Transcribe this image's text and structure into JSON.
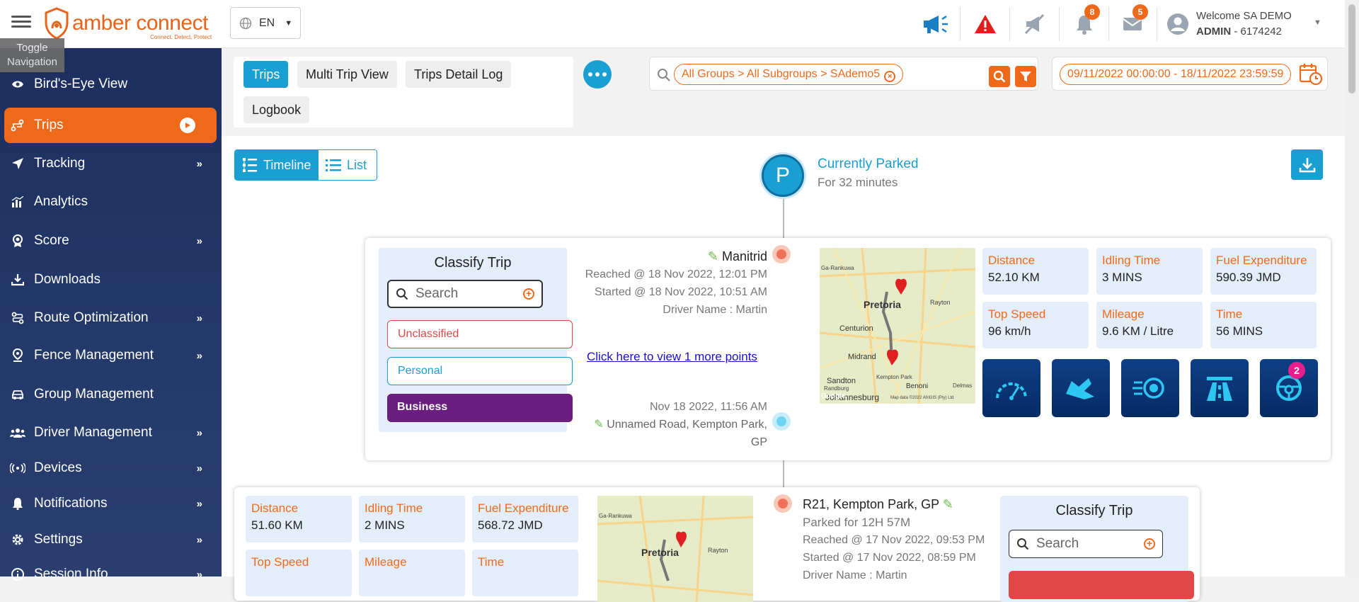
{
  "brand": {
    "name": "amber connect",
    "tagline": "Connect. Detect. Protect"
  },
  "tooltip": "Toggle Navigation",
  "language": {
    "value": "EN"
  },
  "topbar": {
    "notifications_count": "8",
    "messages_count": "5",
    "welcome": "Welcome SA DEMO",
    "user_role": "ADMIN",
    "user_id": " - 6174242"
  },
  "sidebar": {
    "items": [
      {
        "label": "Bird's-Eye View",
        "icon": "eye-icon"
      },
      {
        "label": "Trips",
        "icon": "route-icon",
        "active": true
      },
      {
        "label": "Tracking",
        "icon": "navigation-arrow-icon"
      },
      {
        "label": "Analytics",
        "icon": "bar-chart-icon"
      },
      {
        "label": "Score",
        "icon": "award-icon"
      },
      {
        "label": "Downloads",
        "icon": "download-icon"
      },
      {
        "label": "Route Optimization",
        "icon": "route-optimization-icon"
      },
      {
        "label": "Fence Management",
        "icon": "location-pin-icon"
      },
      {
        "label": "Group Management",
        "icon": "car-icon"
      },
      {
        "label": "Driver Management",
        "icon": "users-icon"
      },
      {
        "label": "Devices",
        "icon": "signal-icon"
      },
      {
        "label": "Notifications",
        "icon": "bell-icon"
      },
      {
        "label": "Settings",
        "icon": "gear-icon"
      },
      {
        "label": "Session Info",
        "icon": "info-icon"
      }
    ]
  },
  "tabs": [
    {
      "label": "Trips",
      "active": true
    },
    {
      "label": "Multi Trip View"
    },
    {
      "label": "Trips Detail Log"
    },
    {
      "label": "Logbook"
    }
  ],
  "filter": {
    "breadcrumb": "All Groups  >  All Subgroups  >  SAdemo5"
  },
  "date_range": "09/11/2022 00:00:00 - 18/11/2022 23:59:59",
  "view_toggle": {
    "timeline": "Timeline",
    "list": "List"
  },
  "parked": {
    "title": "Currently Parked",
    "subtitle": "For 32 minutes"
  },
  "trip1": {
    "classify_title": "Classify Trip",
    "search_placeholder": "Search",
    "classes": [
      "Unclassified",
      "Personal",
      "Business"
    ],
    "end_location": "Manitrid",
    "reached": "Reached @ 18 Nov 2022, 12:01 PM",
    "started": "Started @ 18 Nov 2022, 10:51 AM",
    "driver": "Driver Name : Martin",
    "more_points_link": "Click here to view 1 more points",
    "start_time": "Nov 18 2022, 11:56 AM",
    "start_location_1": "Unnamed Road, Kempton Park,",
    "start_location_2": "GP",
    "stats": [
      {
        "label": "Distance",
        "value": "52.10 KM"
      },
      {
        "label": "Idling Time",
        "value": "3 MINS"
      },
      {
        "label": "Fuel Expenditure",
        "value": "590.39 JMD"
      },
      {
        "label": "Top Speed",
        "value": "96 km/h"
      },
      {
        "label": "Mileage",
        "value": "9.6 KM / Litre"
      },
      {
        "label": "Time",
        "value": "56 MINS"
      }
    ],
    "action_badge": "2",
    "map_labels": [
      "Ga-Rankuwa",
      "Pretoria",
      "Rayton",
      "Centurion",
      "Midrand",
      "Kempton Park",
      "Sandton",
      "Randburg",
      "Benoni",
      "Delmas",
      "Johannesburg",
      "Google",
      "Map data ©2022 AfriGIS (Pty) Ltd"
    ]
  },
  "trip2": {
    "stats": [
      {
        "label": "Distance",
        "value": "51.60 KM"
      },
      {
        "label": "Idling Time",
        "value": "2 MINS"
      },
      {
        "label": "Fuel Expenditure",
        "value": "568.72 JMD"
      },
      {
        "label": "Top Speed",
        "value": ""
      },
      {
        "label": "Mileage",
        "value": ""
      },
      {
        "label": "Time",
        "value": ""
      }
    ],
    "end_location": "R21, Kempton Park, GP",
    "parked_for": "Parked for 12H 57M",
    "reached": "Reached @ 17 Nov 2022, 09:53 PM",
    "started": "Started @ 17 Nov 2022, 08:59 PM",
    "driver": "Driver Name : Martin",
    "classify_title": "Classify Trip",
    "search_placeholder": "Search",
    "map_labels": [
      "Ga-Rankuwa",
      "Pretoria",
      "Rayton"
    ]
  },
  "colors": {
    "accent": "#ee6a1a",
    "primary": "#1a9fd2",
    "nav": "#1d2f5e",
    "business": "#6a1f7f"
  }
}
